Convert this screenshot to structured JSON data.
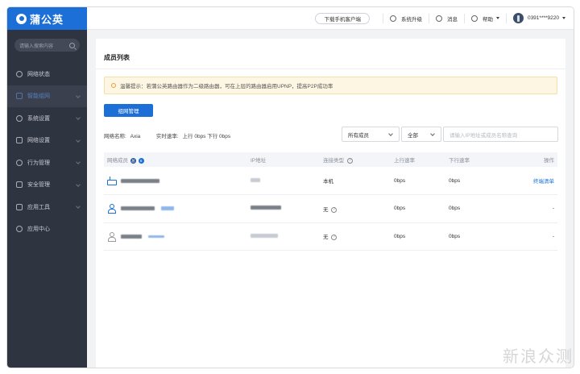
{
  "brand": {
    "name": "蒲公英"
  },
  "sidebar": {
    "search_placeholder": "请输入搜索内容",
    "items": [
      {
        "label": "网络状态",
        "icon": "network-status-icon",
        "active": false,
        "expandable": false
      },
      {
        "label": "智能组网",
        "icon": "smart-network-icon",
        "active": true,
        "expandable": true
      },
      {
        "label": "系统设置",
        "icon": "system-settings-icon",
        "active": false,
        "expandable": true
      },
      {
        "label": "网络设置",
        "icon": "network-settings-icon",
        "active": false,
        "expandable": true
      },
      {
        "label": "行为管理",
        "icon": "behavior-icon",
        "active": false,
        "expandable": true
      },
      {
        "label": "安全管理",
        "icon": "security-icon",
        "active": false,
        "expandable": true
      },
      {
        "label": "应用工具",
        "icon": "tools-icon",
        "active": false,
        "expandable": true
      },
      {
        "label": "应用中心",
        "icon": "app-center-icon",
        "active": false,
        "expandable": false
      }
    ]
  },
  "topbar": {
    "download_label": "下载手机客户端",
    "upgrade_label": "系统升级",
    "messages_label": "消息",
    "help_label": "帮助",
    "account_label": "0391****9220"
  },
  "main": {
    "title": "成员列表",
    "notice": "温馨提示：若蒲公英路由器作为二级路由器，可在上层的路由器启用UPNP，提高P2P成功率",
    "group_button": "组网管理",
    "network_name_label": "网络名称:",
    "network_name": "Axia",
    "speed_label": "实时速率:",
    "speed_value": "上行 0bps 下行 0bps",
    "filter_members": "所有成员",
    "filter_all": "全部",
    "search_placeholder": "请输入IP地址或成员名称查询",
    "columns": {
      "member": "网络成员",
      "ip": "IP地址",
      "conn": "连接类型",
      "up": "上行速率",
      "down": "下行速率",
      "action": "操作"
    },
    "member_badges": [
      "总",
      "6"
    ],
    "rows": [
      {
        "conn": "本机",
        "up": "0bps",
        "down": "0bps",
        "action": "终端清单"
      },
      {
        "conn": "无",
        "up": "0bps",
        "down": "0bps",
        "action": "-"
      },
      {
        "conn": "无",
        "up": "0bps",
        "down": "0bps",
        "action": "-"
      }
    ]
  },
  "watermark": "新浪众测",
  "colors": {
    "brand_blue": "#1b6fd6",
    "sidebar_bg": "#2f3441",
    "notice_bg": "#fdf6e3"
  }
}
